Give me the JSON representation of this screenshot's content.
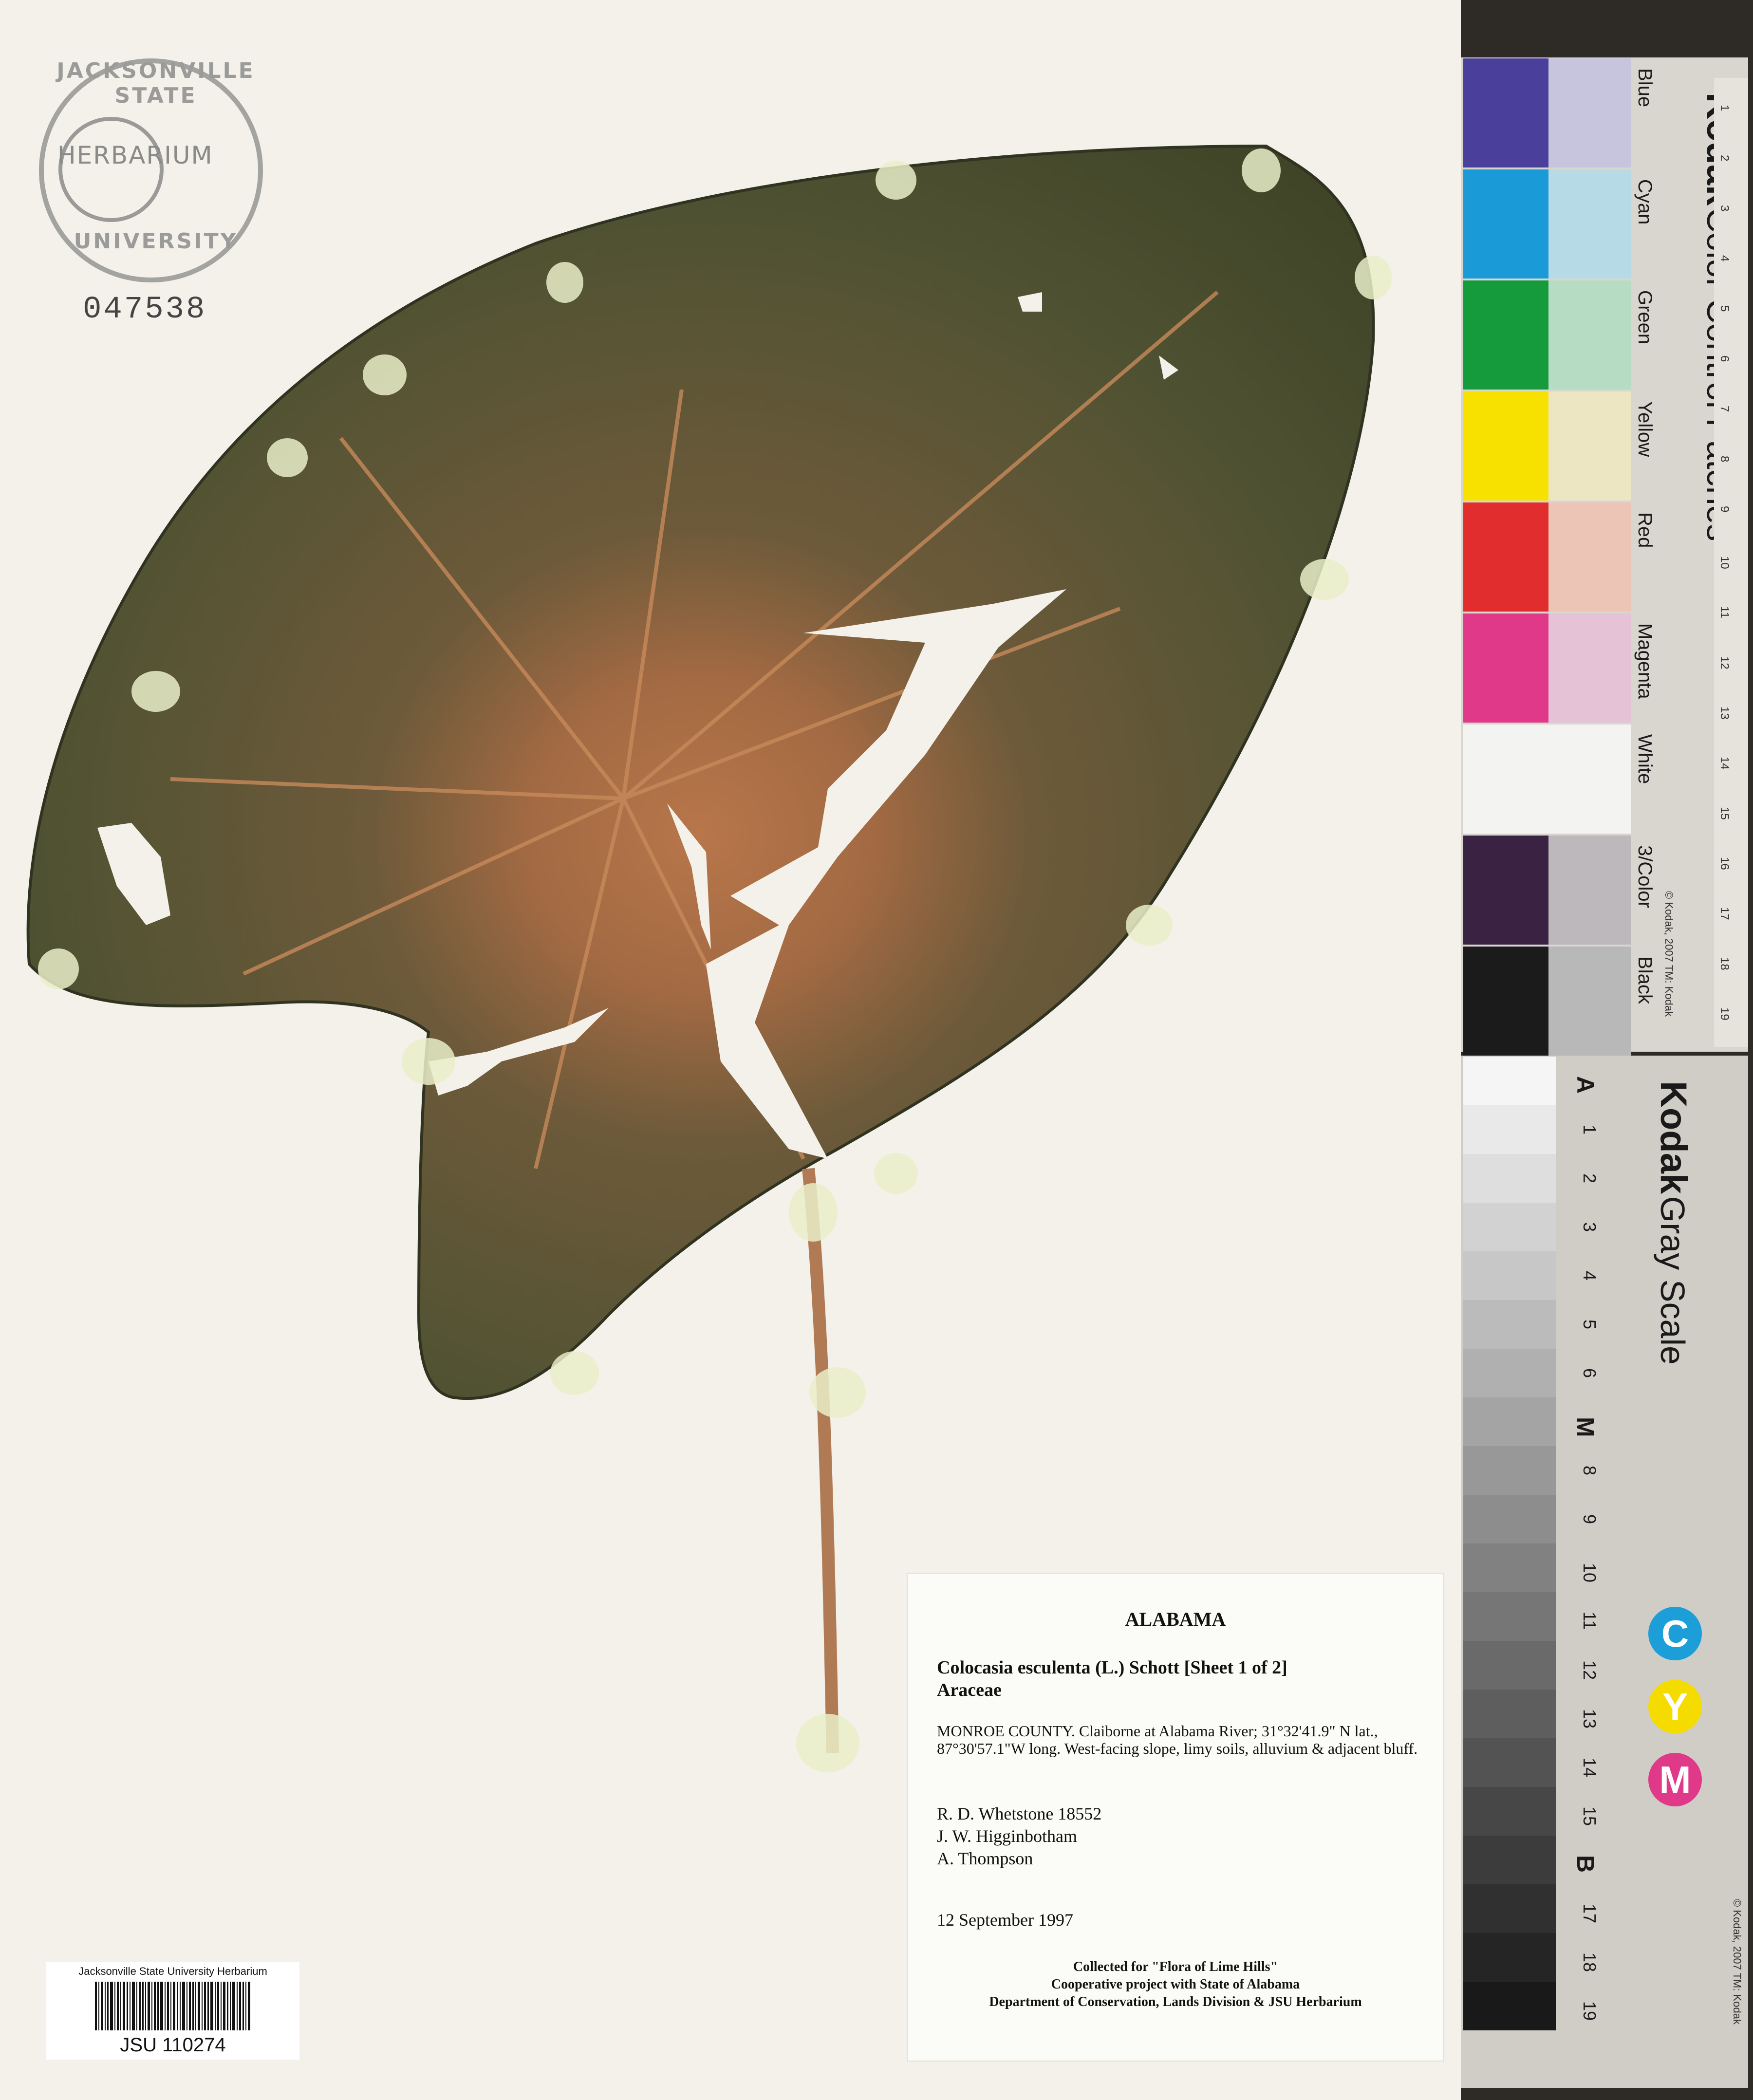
{
  "herbarium_stamp": {
    "top_text": "JACKSONVILLE STATE",
    "middle_text": "HERBARIUM",
    "bottom_text": "UNIVERSITY",
    "accession_number": "047538"
  },
  "specimen_label": {
    "state": "ALABAMA",
    "taxon": "Colocasia esculenta (L.) Schott [Sheet 1 of 2]",
    "family": "Araceae",
    "locality": "MONROE COUNTY.  Claiborne at Alabama River; 31°32'41.9\" N lat., 87°30'57.1\"W long.  West-facing slope, limy soils, alluvium & adjacent bluff.",
    "collectors": [
      "R. D. Whetstone 18552",
      "J. W. Higginbotham",
      "A. Thompson"
    ],
    "date": "12 September 1997",
    "footer": [
      "Collected for \"Flora of Lime Hills\"",
      "Cooperative project with State of Alabama",
      "Department of Conservation, Lands Division & JSU Herbarium"
    ]
  },
  "barcode": {
    "institution": "Jacksonville State University Herbarium",
    "number": "JSU 110274"
  },
  "color_card": {
    "brand": "Kodak",
    "title": "Color Control Patches",
    "patches": [
      {
        "label": "Blue",
        "color": "#4a3f9a",
        "tint": "#c7c4dd"
      },
      {
        "label": "Cyan",
        "color": "#1a9bd7",
        "tint": "#b6dbe6"
      },
      {
        "label": "Green",
        "color": "#159a3c",
        "tint": "#b7dcc4"
      },
      {
        "label": "Yellow",
        "color": "#f7e100",
        "tint": "#ece6c2"
      },
      {
        "label": "Red",
        "color": "#e12d2d",
        "tint": "#edc5b6"
      },
      {
        "label": "Magenta",
        "color": "#e0398a",
        "tint": "#e6c2d6"
      },
      {
        "label": "White",
        "color": "#f3f3f1",
        "tint": "#f3f3f1"
      },
      {
        "label": "3/Color",
        "color": "#3a2342",
        "tint": "#bdb8bc"
      },
      {
        "label": "Black",
        "color": "#1c1b1c",
        "tint": "#b8b8b8"
      }
    ],
    "copyright": "© Kodak, 2007  TM: Kodak",
    "ruler_numbers": [
      "1",
      "2",
      "3",
      "4",
      "5",
      "6",
      "7",
      "8",
      "9",
      "10",
      "11",
      "12",
      "13",
      "14",
      "15",
      "16",
      "17",
      "18",
      "19"
    ]
  },
  "gray_card": {
    "brand": "Kodak",
    "title": "Gray Scale",
    "steps": [
      "A",
      "1",
      "2",
      "3",
      "4",
      "5",
      "6",
      "M",
      "8",
      "9",
      "10",
      "11",
      "12",
      "13",
      "14",
      "15",
      "B",
      "17",
      "18",
      "19"
    ],
    "cym": [
      "C",
      "Y",
      "M"
    ],
    "copyright": "© Kodak, 2007  TM: Kodak"
  }
}
